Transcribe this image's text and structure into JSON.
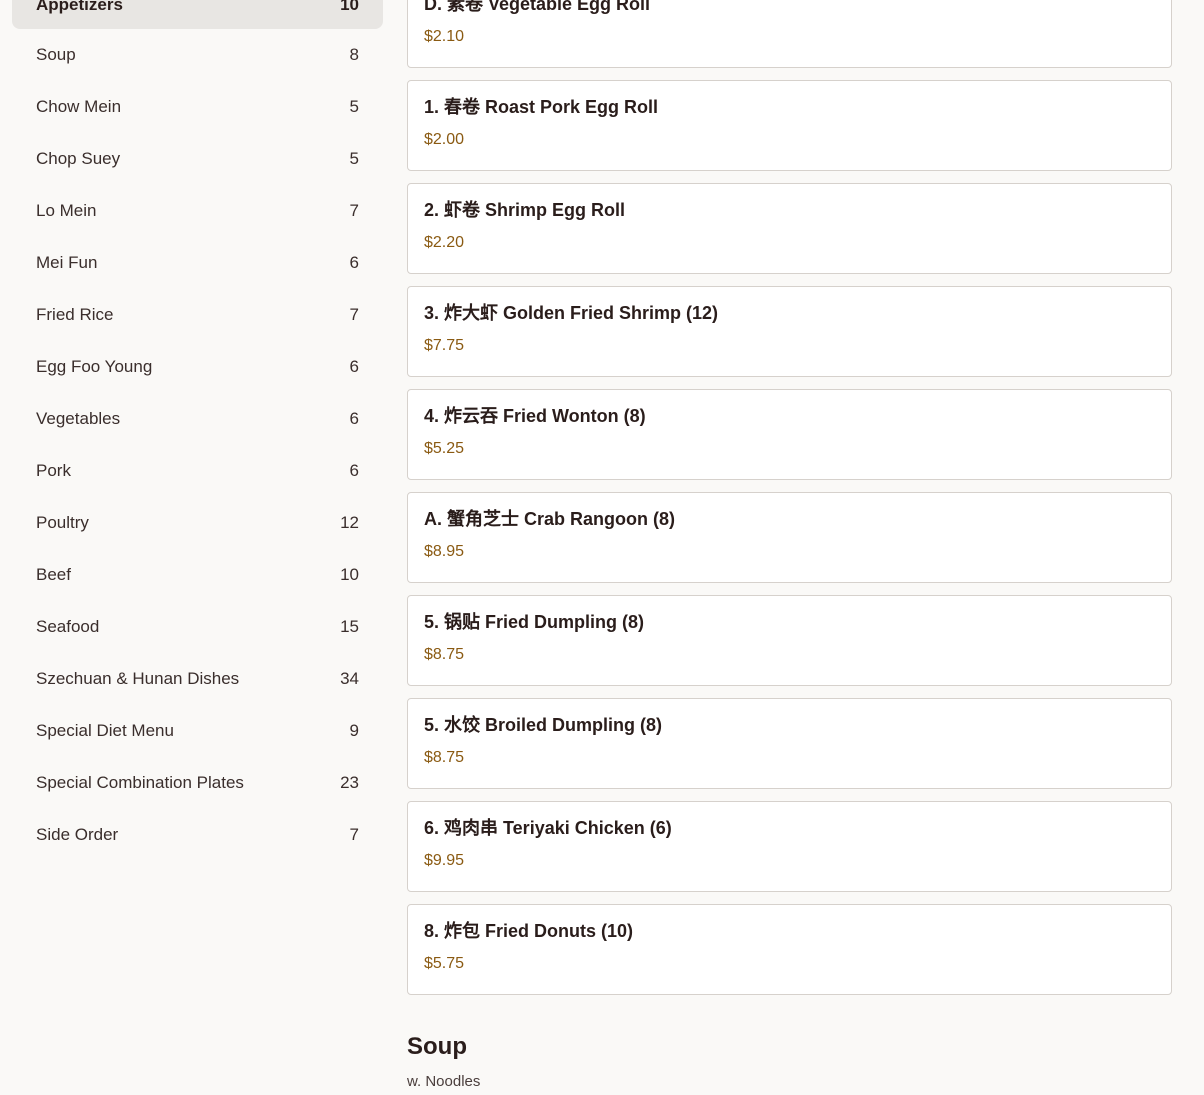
{
  "sidebar": {
    "categories": [
      {
        "label": "Appetizers",
        "count": "10"
      },
      {
        "label": "Soup",
        "count": "8"
      },
      {
        "label": "Chow Mein",
        "count": "5"
      },
      {
        "label": "Chop Suey",
        "count": "5"
      },
      {
        "label": "Lo Mein",
        "count": "7"
      },
      {
        "label": "Mei Fun",
        "count": "6"
      },
      {
        "label": "Fried Rice",
        "count": "7"
      },
      {
        "label": "Egg Foo Young",
        "count": "6"
      },
      {
        "label": "Vegetables",
        "count": "6"
      },
      {
        "label": "Pork",
        "count": "6"
      },
      {
        "label": "Poultry",
        "count": "12"
      },
      {
        "label": "Beef",
        "count": "10"
      },
      {
        "label": "Seafood",
        "count": "15"
      },
      {
        "label": "Szechuan & Hunan Dishes",
        "count": "34"
      },
      {
        "label": "Special Diet Menu",
        "count": "9"
      },
      {
        "label": "Special Combination Plates",
        "count": "23"
      },
      {
        "label": "Side Order",
        "count": "7"
      }
    ]
  },
  "menu": {
    "items": [
      {
        "name": "D. 素卷 Vegetable Egg Roll",
        "price": "$2.10"
      },
      {
        "name": "1. 春卷 Roast Pork Egg Roll",
        "price": "$2.00"
      },
      {
        "name": "2. 虾卷 Shrimp Egg Roll",
        "price": "$2.20"
      },
      {
        "name": "3. 炸大虾 Golden Fried Shrimp (12)",
        "price": "$7.75"
      },
      {
        "name": "4. 炸云吞 Fried Wonton (8)",
        "price": "$5.25"
      },
      {
        "name": "A. 蟹角芝士 Crab Rangoon (8)",
        "price": "$8.95"
      },
      {
        "name": "5. 锅贴 Fried Dumpling (8)",
        "price": "$8.75"
      },
      {
        "name": "5. 水饺 Broiled Dumpling (8)",
        "price": "$8.75"
      },
      {
        "name": "6. 鸡肉串 Teriyaki Chicken (6)",
        "price": "$9.95"
      },
      {
        "name": "8. 炸包 Fried Donuts (10)",
        "price": "$5.75"
      }
    ]
  },
  "next_section": {
    "title": "Soup",
    "subtitle": "w. Noodles"
  }
}
